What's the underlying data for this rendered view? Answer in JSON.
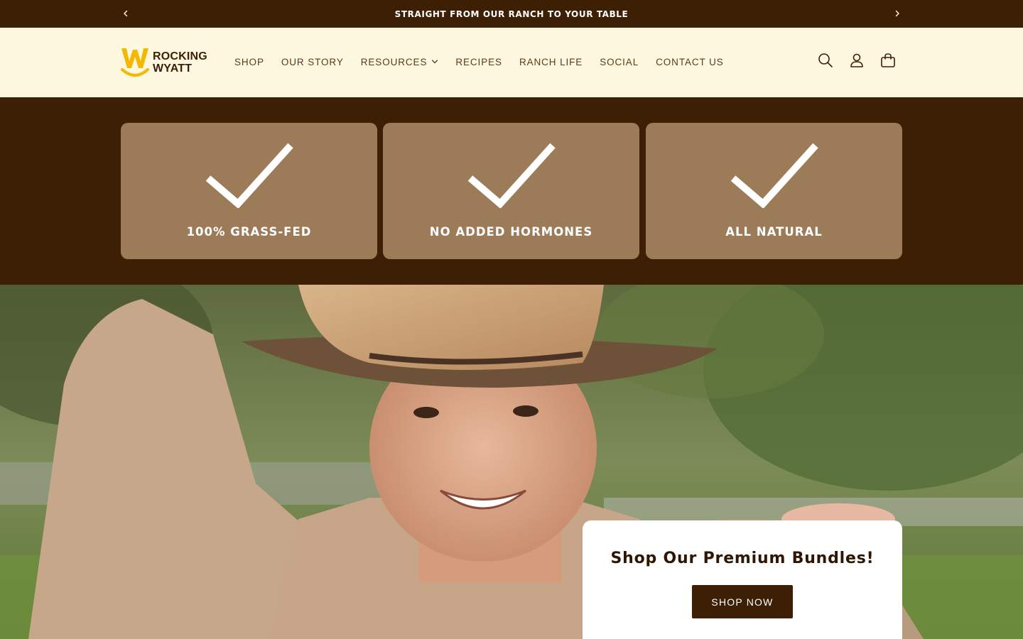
{
  "announcement": {
    "text": "STRAIGHT FROM OUR RANCH TO YOUR TABLE",
    "prev_icon": "chevron-left-icon",
    "next_icon": "chevron-right-icon"
  },
  "brand": {
    "name_line1": "ROCKING",
    "name_line2": "WYATT",
    "logo_icon": "w-smile-logo",
    "accent_color": "#f5b800"
  },
  "nav": {
    "items": [
      {
        "label": "SHOP"
      },
      {
        "label": "OUR STORY"
      },
      {
        "label": "RESOURCES",
        "has_dropdown": true
      },
      {
        "label": "RECIPES"
      },
      {
        "label": "RANCH LIFE"
      },
      {
        "label": "SOCIAL"
      },
      {
        "label": "CONTACT US"
      }
    ]
  },
  "header_icons": [
    "search-icon",
    "account-icon",
    "cart-icon"
  ],
  "features": [
    {
      "label": "100% GRASS-FED",
      "icon": "checkmark-icon"
    },
    {
      "label": "NO ADDED HORMONES",
      "icon": "checkmark-icon"
    },
    {
      "label": "ALL NATURAL",
      "icon": "checkmark-icon"
    }
  ],
  "hero": {
    "image_subject": "smiling boy in cowboy hat outdoors",
    "promo_title": "Shop Our Premium Bundles!",
    "promo_button": "SHOP NOW"
  },
  "colors": {
    "dark_brown": "#3c1f04",
    "cream": "#fff8e1",
    "tan": "#9c7b59",
    "white": "#ffffff"
  }
}
